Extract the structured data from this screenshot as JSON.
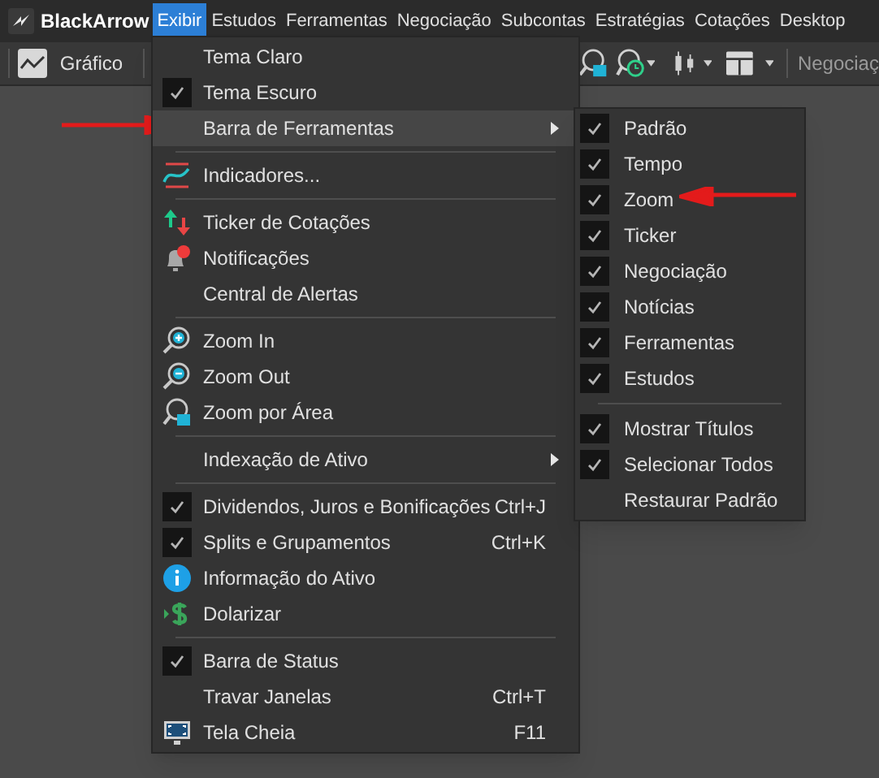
{
  "app": {
    "title": "BlackArrow"
  },
  "menubar": [
    {
      "label": "Exibir",
      "selected": true
    },
    {
      "label": "Estudos",
      "selected": false
    },
    {
      "label": "Ferramentas",
      "selected": false
    },
    {
      "label": "Negociação",
      "selected": false
    },
    {
      "label": "Subcontas",
      "selected": false
    },
    {
      "label": "Estratégias",
      "selected": false
    },
    {
      "label": "Cotações",
      "selected": false
    },
    {
      "label": "Desktop",
      "selected": false
    }
  ],
  "toolbar": {
    "chart_button": "Gráfico",
    "right_label": "Negociaç"
  },
  "menu": {
    "sections": [
      [
        {
          "label": "Tema Claro",
          "checked": false,
          "selected": false
        },
        {
          "label": "Tema Escuro",
          "checked": true,
          "selected": false
        },
        {
          "label": "Barra de Ferramentas",
          "submenu": true,
          "selected": true
        }
      ],
      [
        {
          "label": "Indicadores...",
          "selected": false
        }
      ],
      [
        {
          "label": "Ticker de Cotações",
          "selected": false
        },
        {
          "label": "Notificações",
          "selected": false
        },
        {
          "label": "Central de Alertas",
          "selected": false
        }
      ],
      [
        {
          "label": "Zoom In",
          "selected": false
        },
        {
          "label": "Zoom Out",
          "selected": false
        },
        {
          "label": "Zoom por Área",
          "selected": false
        }
      ],
      [
        {
          "label": "Indexação de Ativo",
          "submenu": true,
          "selected": false
        }
      ],
      [
        {
          "label": "Dividendos, Juros e Bonificações",
          "checked": true,
          "shortcut": "Ctrl+J",
          "selected": false
        },
        {
          "label": "Splits e Grupamentos",
          "checked": true,
          "shortcut": "Ctrl+K",
          "selected": false
        },
        {
          "label": "Informação do Ativo",
          "selected": false
        },
        {
          "label": "Dolarizar",
          "selected": false
        }
      ],
      [
        {
          "label": "Barra de Status",
          "checked": true,
          "selected": false
        },
        {
          "label": "Travar Janelas",
          "checked": false,
          "shortcut": "Ctrl+T",
          "selected": false
        },
        {
          "label": "Tela Cheia",
          "shortcut": "F11",
          "selected": false
        }
      ]
    ]
  },
  "submenu": {
    "sections": [
      [
        {
          "label": "Padrão",
          "checked": true
        },
        {
          "label": "Tempo",
          "checked": true
        },
        {
          "label": "Zoom",
          "checked": true
        },
        {
          "label": "Ticker",
          "checked": true
        },
        {
          "label": "Negociação",
          "checked": true
        },
        {
          "label": "Notícias",
          "checked": true
        },
        {
          "label": "Ferramentas",
          "checked": true
        },
        {
          "label": "Estudos",
          "checked": true
        }
      ],
      [
        {
          "label": "Mostrar Títulos",
          "checked": true
        },
        {
          "label": "Selecionar Todos",
          "checked": true
        },
        {
          "label": "Restaurar Padrão",
          "checked": false
        }
      ]
    ]
  }
}
